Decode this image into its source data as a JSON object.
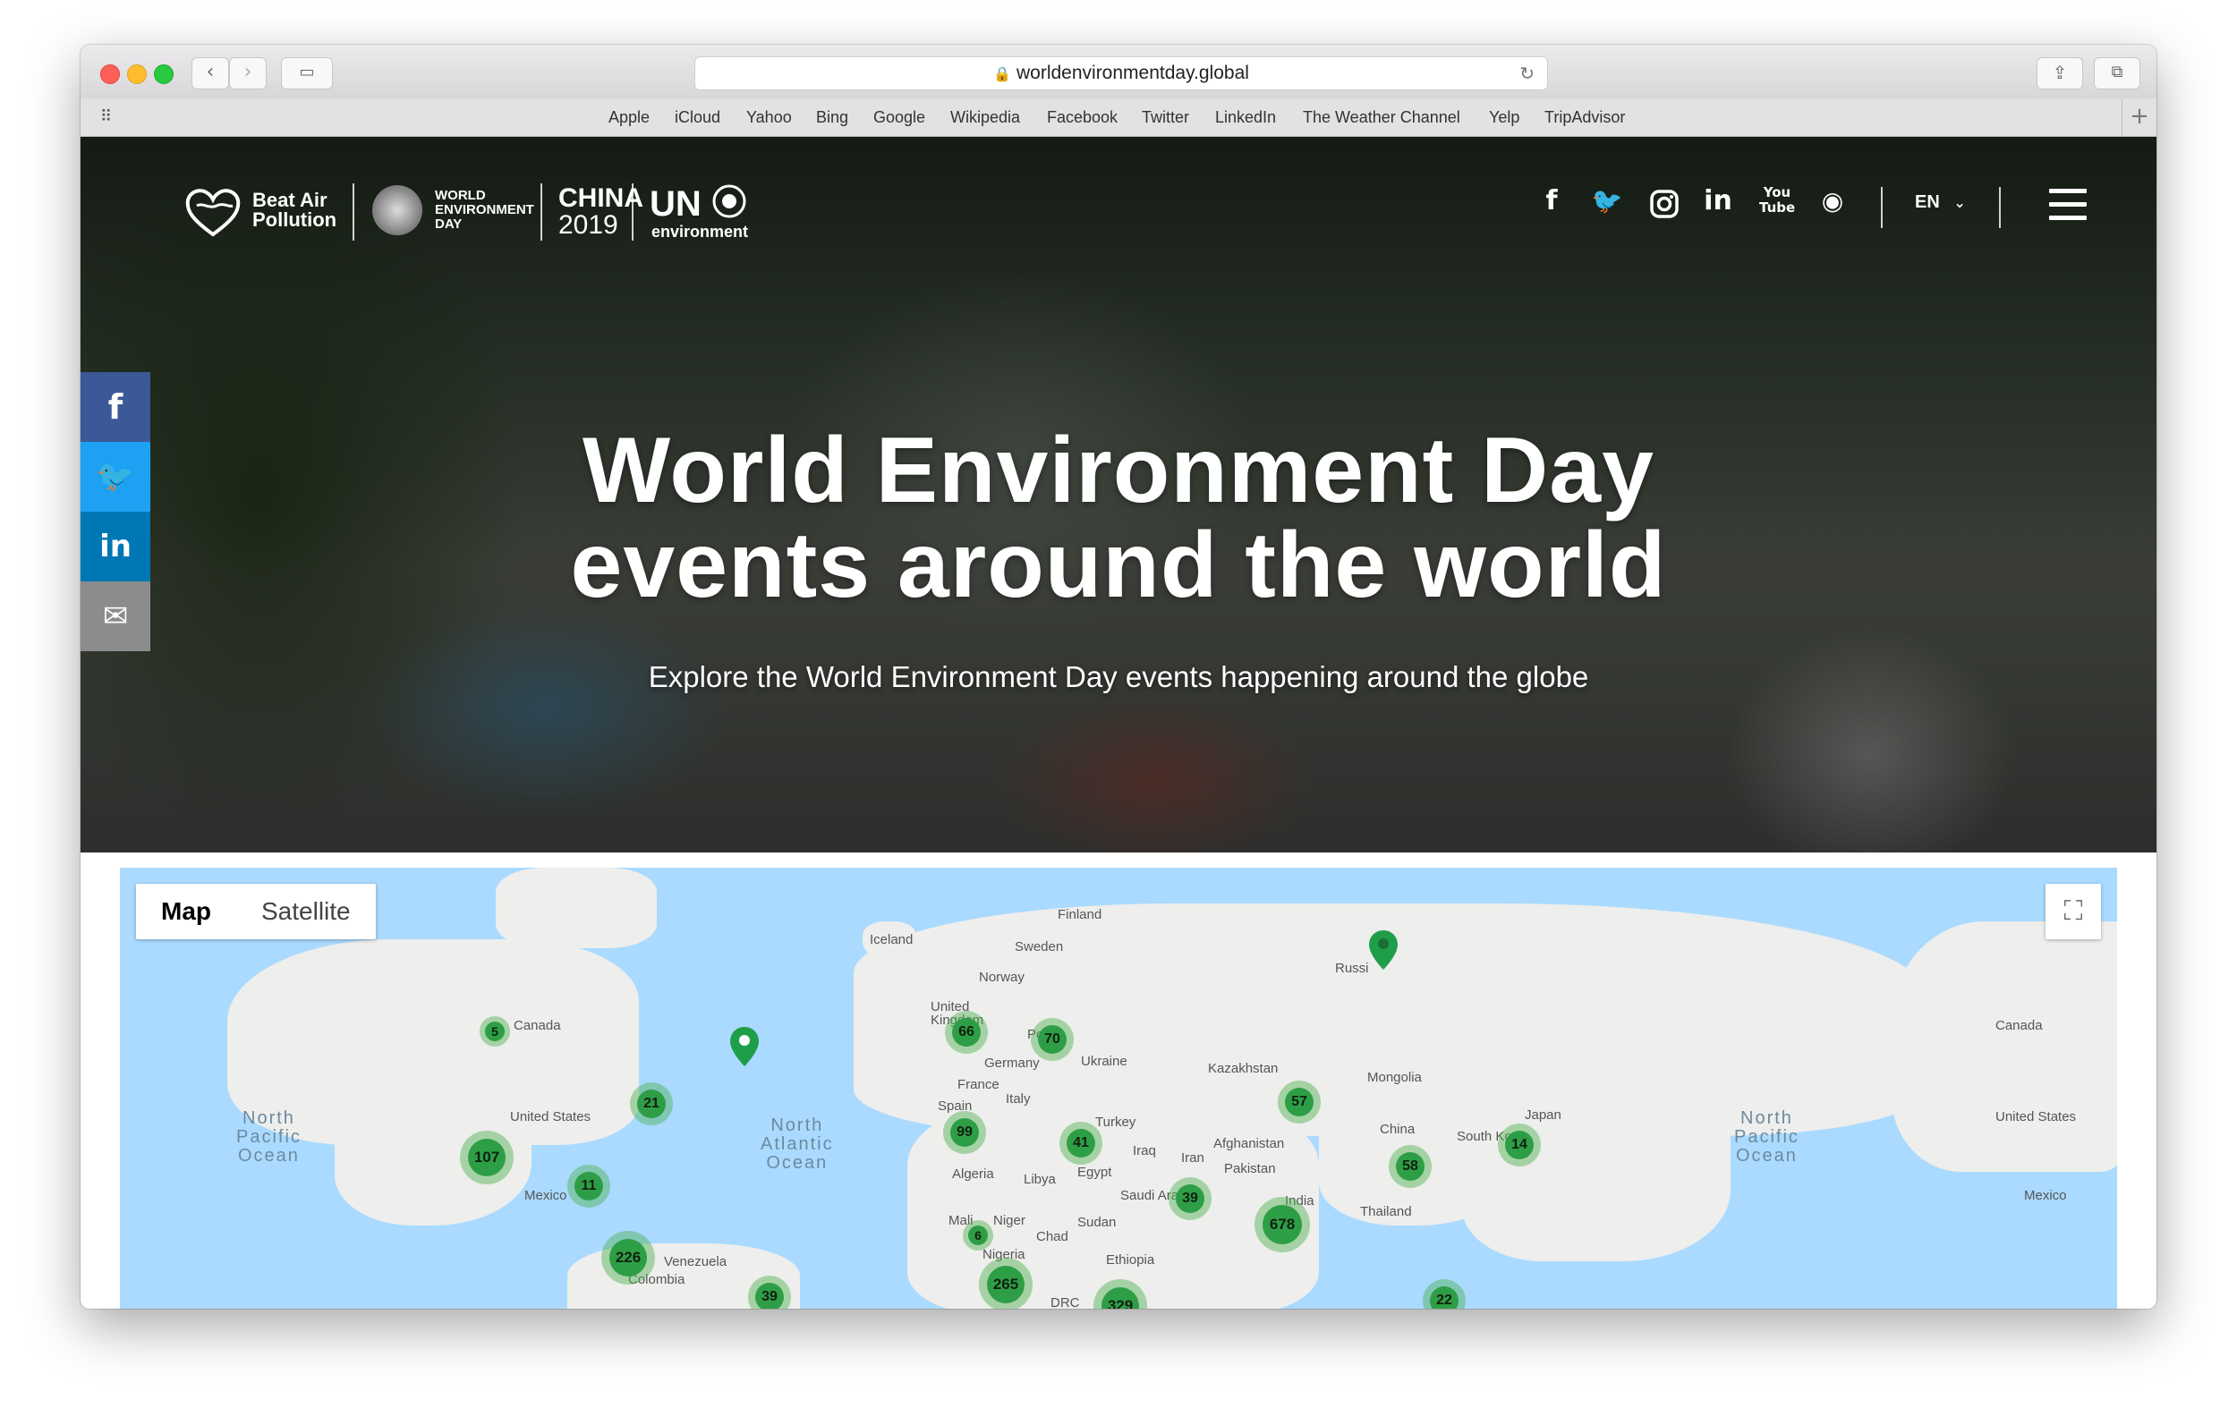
{
  "browser": {
    "url": "worldenvironmentday.global",
    "bookmarks": [
      "Apple",
      "iCloud",
      "Yahoo",
      "Bing",
      "Google",
      "Wikipedia",
      "Facebook",
      "Twitter",
      "LinkedIn",
      "The Weather Channel",
      "Yelp",
      "TripAdvisor"
    ]
  },
  "header": {
    "logo_beat_line1": "Beat Air",
    "logo_beat_line2": "Pollution",
    "logo_wed_line1": "WORLD",
    "logo_wed_line2": "ENVIRONMENT",
    "logo_wed_line3": "DAY",
    "logo_china": "CHINA",
    "logo_year": "2019",
    "logo_un": "UN",
    "logo_un_sub": "environment",
    "social_icons": [
      "facebook-icon",
      "twitter-icon",
      "instagram-icon",
      "linkedin-icon",
      "youtube-icon",
      "weibo-icon"
    ],
    "language": "EN"
  },
  "hero": {
    "title_line1": "World Environment Day",
    "title_line2": "events around the world",
    "subtitle": "Explore the World Environment Day events happening around the globe"
  },
  "share_bar": {
    "colors": {
      "facebook": "#3b5998",
      "twitter": "#1da1f2",
      "linkedin": "#0077b5",
      "email": "#8c8c8c"
    }
  },
  "map": {
    "toggle": {
      "map": "Map",
      "satellite": "Satellite"
    },
    "labels": {
      "canada": "Canada",
      "united_states": "United States",
      "mexico": "Mexico",
      "venezuela": "Venezuela",
      "colombia": "Colombia",
      "iceland": "Iceland",
      "finland": "Finland",
      "sweden": "Sweden",
      "norway": "Norway",
      "united_kingdom": "United Kingdom",
      "poland": "Po",
      "germany": "Germany",
      "ukraine": "Ukraine",
      "france": "France",
      "italy": "Italy",
      "spain": "Spain",
      "turkey": "Turkey",
      "iraq": "Iraq",
      "iran": "Iran",
      "afghanistan": "Afghanistan",
      "pakistan": "Pakistan",
      "saudi_arabia": "Saudi Ara",
      "egypt": "Egypt",
      "libya": "Libya",
      "algeria": "Algeria",
      "mali": "Mali",
      "niger": "Niger",
      "chad": "Chad",
      "sudan": "Sudan",
      "nigeria": "Nigeria",
      "ethiopia": "Ethiopia",
      "drc": "DRC",
      "kazakhstan": "Kazakhstan",
      "mongolia": "Mongolia",
      "china": "China",
      "india": "India",
      "thailand": "Thailand",
      "south_korea": "South Kor",
      "japan": "Japan",
      "russia": "Russi",
      "canada_right": "Canada",
      "united_states_right": "United States",
      "mexico_right": "Mexico"
    },
    "oceans": {
      "north_pacific_line1": "North",
      "north_pacific_line2": "Pacific",
      "north_pacific_line3": "Ocean",
      "north_atlantic_line1": "North",
      "north_atlantic_line2": "Atlantic",
      "north_atlantic_line3": "Ocean"
    },
    "clusters": [
      "5",
      "21",
      "107",
      "11",
      "226",
      "39",
      "66",
      "70",
      "99",
      "41",
      "6",
      "265",
      "329",
      "57",
      "39",
      "678",
      "58",
      "14",
      "22"
    ]
  }
}
